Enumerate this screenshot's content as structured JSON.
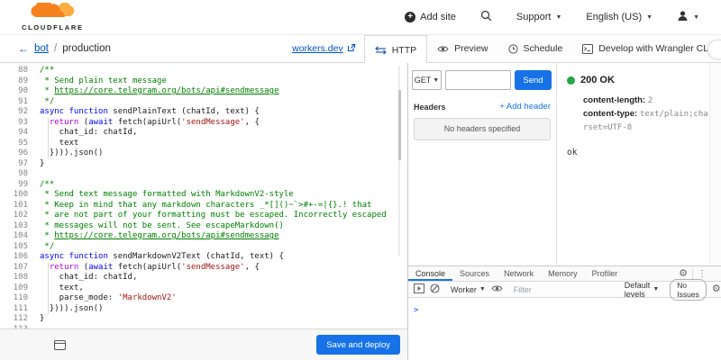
{
  "colors": {
    "brand_orange": "#f6821f",
    "brand_orange_light": "#fbad41",
    "accent_blue": "#1672e6",
    "link_blue": "#0051c3",
    "status_green": "#28a745",
    "devtools_active_blue": "#1a73e8",
    "syntax_keyword": "#0000ff",
    "syntax_control": "#af00db",
    "syntax_string": "#a31515",
    "syntax_comment": "#008000"
  },
  "header": {
    "brand": "CLOUDFLARE",
    "add_site": "Add site",
    "support": "Support",
    "language": "English (US)"
  },
  "breadcrumb": {
    "back": "←",
    "project": "bot",
    "separator": "/",
    "environment": "production",
    "workers_link": "workers.dev"
  },
  "tabs": [
    {
      "label": "HTTP",
      "icon": "http-arrows-icon",
      "active": true
    },
    {
      "label": "Preview",
      "icon": "eye-icon",
      "active": false
    },
    {
      "label": "Schedule",
      "icon": "clock-icon",
      "active": false
    },
    {
      "label": "Develop with Wrangler CLI",
      "icon": "terminal-icon",
      "active": false
    }
  ],
  "editor": {
    "footer": {
      "save_button": "Save and deploy"
    },
    "lines": [
      {
        "n": "88",
        "g": 0,
        "t": [
          [
            "c",
            "/**"
          ]
        ]
      },
      {
        "n": "89",
        "g": 0,
        "t": [
          [
            "c",
            " * Send plain text message"
          ]
        ]
      },
      {
        "n": "90",
        "g": 0,
        "t": [
          [
            "c",
            " * "
          ],
          [
            "u",
            "https://core.telegram.org/bots/api#sendmessage"
          ]
        ]
      },
      {
        "n": "91",
        "g": 0,
        "t": [
          [
            "c",
            " */"
          ]
        ]
      },
      {
        "n": "92",
        "g": 0,
        "t": [
          [
            "k",
            "async"
          ],
          [
            "t",
            " "
          ],
          [
            "k",
            "function"
          ],
          [
            "t",
            " sendPlainText (chatId, text) {"
          ]
        ]
      },
      {
        "n": "93",
        "g": 1,
        "t": [
          [
            "t",
            "  "
          ],
          [
            "r",
            "return"
          ],
          [
            "t",
            " ("
          ],
          [
            "k",
            "await"
          ],
          [
            "t",
            " fetch(apiUrl("
          ],
          [
            "s",
            "'sendMessage'"
          ],
          [
            "t",
            ", {"
          ]
        ]
      },
      {
        "n": "94",
        "g": 1,
        "t": [
          [
            "t",
            "    chat_id: chatId,"
          ]
        ]
      },
      {
        "n": "95",
        "g": 1,
        "t": [
          [
            "t",
            "    text"
          ]
        ]
      },
      {
        "n": "96",
        "g": 1,
        "t": [
          [
            "t",
            "  }))).json()"
          ]
        ]
      },
      {
        "n": "97",
        "g": 0,
        "t": [
          [
            "t",
            "}"
          ]
        ]
      },
      {
        "n": "98",
        "g": 0,
        "t": []
      },
      {
        "n": "99",
        "g": 0,
        "t": [
          [
            "c",
            "/**"
          ]
        ]
      },
      {
        "n": "100",
        "g": 0,
        "t": [
          [
            "c",
            " * Send text message formatted with MarkdownV2-style"
          ]
        ]
      },
      {
        "n": "101",
        "g": 0,
        "t": [
          [
            "c",
            " * Keep in mind that any markdown characters _*[]()~`>#+-=|{}.! that"
          ]
        ]
      },
      {
        "n": "102",
        "g": 0,
        "t": [
          [
            "c",
            " * are not part of your formatting must be escaped. Incorrectly escaped"
          ]
        ]
      },
      {
        "n": "103",
        "g": 0,
        "t": [
          [
            "c",
            " * messages will not be sent. See escapeMarkdown()"
          ]
        ]
      },
      {
        "n": "104",
        "g": 0,
        "t": [
          [
            "c",
            " * "
          ],
          [
            "u",
            "https://core.telegram.org/bots/api#sendmessage"
          ]
        ]
      },
      {
        "n": "105",
        "g": 0,
        "t": [
          [
            "c",
            " */"
          ]
        ]
      },
      {
        "n": "106",
        "g": 0,
        "t": [
          [
            "k",
            "async"
          ],
          [
            "t",
            " "
          ],
          [
            "k",
            "function"
          ],
          [
            "t",
            " sendMarkdownV2Text (chatId, text) {"
          ]
        ]
      },
      {
        "n": "107",
        "g": 1,
        "t": [
          [
            "t",
            "  "
          ],
          [
            "r",
            "return"
          ],
          [
            "t",
            " ("
          ],
          [
            "k",
            "await"
          ],
          [
            "t",
            " fetch(apiUrl("
          ],
          [
            "s",
            "'sendMessage'"
          ],
          [
            "t",
            ", {"
          ]
        ]
      },
      {
        "n": "108",
        "g": 1,
        "t": [
          [
            "t",
            "    chat_id: chatId,"
          ]
        ]
      },
      {
        "n": "109",
        "g": 1,
        "t": [
          [
            "t",
            "    text,"
          ]
        ]
      },
      {
        "n": "110",
        "g": 1,
        "t": [
          [
            "t",
            "    parse_mode: "
          ],
          [
            "s",
            "'MarkdownV2'"
          ]
        ]
      },
      {
        "n": "111",
        "g": 1,
        "t": [
          [
            "t",
            "  }))).json()"
          ]
        ]
      },
      {
        "n": "112",
        "g": 0,
        "t": [
          [
            "t",
            "}"
          ]
        ]
      },
      {
        "n": "113",
        "g": 0,
        "t": []
      }
    ]
  },
  "http_panel": {
    "method": "GET",
    "url_value": "",
    "send_button": "Send",
    "headers_label": "Headers",
    "add_header_label": "+ Add header",
    "no_headers_text": "No headers specified",
    "response": {
      "status": "200 OK",
      "headers": [
        {
          "key": "content-length",
          "value": "2"
        },
        {
          "key": "content-type",
          "value": "text/plain;charset=UTF-8"
        }
      ],
      "body": "ok"
    }
  },
  "console": {
    "tabs": [
      "Console",
      "Sources",
      "Network",
      "Memory",
      "Profiler"
    ],
    "active_tab": "Console",
    "toolbar": {
      "worker_label": "Worker",
      "filter_placeholder": "Filter",
      "levels_label": "Default levels",
      "no_issues_label": "No Issues"
    },
    "prompt": ">"
  }
}
